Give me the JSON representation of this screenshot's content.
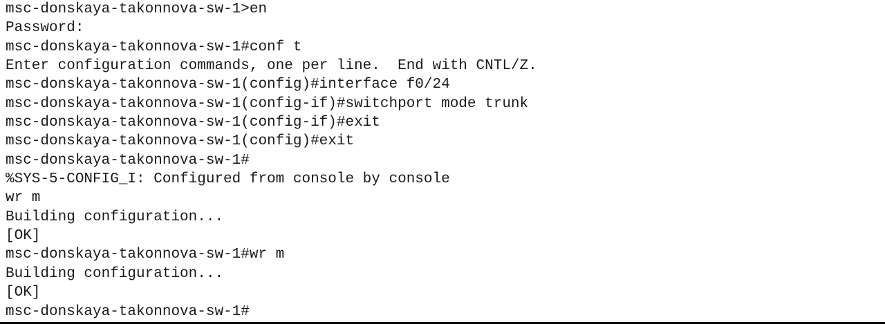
{
  "terminal": {
    "lines": [
      "msc-donskaya-takonnova-sw-1>en",
      "Password:",
      "msc-donskaya-takonnova-sw-1#conf t",
      "Enter configuration commands, one per line.  End with CNTL/Z.",
      "msc-donskaya-takonnova-sw-1(config)#interface f0/24",
      "msc-donskaya-takonnova-sw-1(config-if)#switchport mode trunk",
      "msc-donskaya-takonnova-sw-1(config-if)#exit",
      "msc-donskaya-takonnova-sw-1(config)#exit",
      "msc-donskaya-takonnova-sw-1#",
      "%SYS-5-CONFIG_I: Configured from console by console",
      "wr m",
      "Building configuration...",
      "[OK]",
      "msc-donskaya-takonnova-sw-1#wr m",
      "Building configuration...",
      "[OK]",
      "msc-donskaya-takonnova-sw-1#"
    ]
  }
}
